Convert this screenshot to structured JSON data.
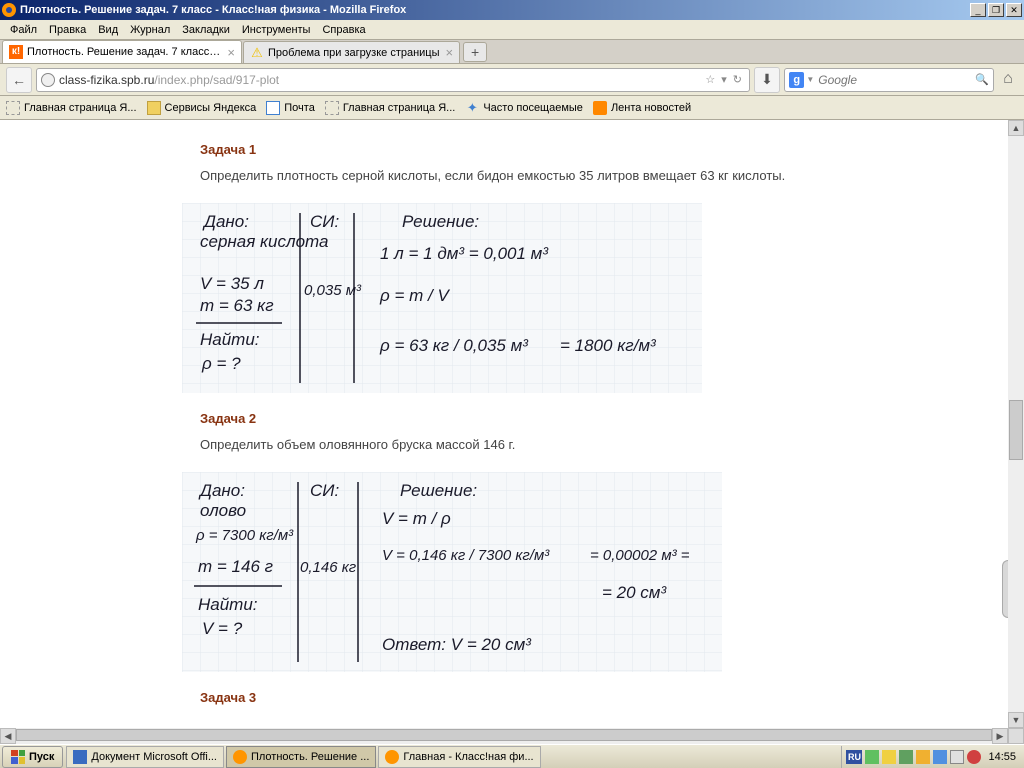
{
  "window": {
    "title": "Плотность. Решение задач. 7 класс - Класс!ная физика - Mozilla Firefox"
  },
  "menu": {
    "file": "Файл",
    "edit": "Правка",
    "view": "Вид",
    "journal": "Журнал",
    "bookmarks": "Закладки",
    "tools": "Инструменты",
    "help": "Справка"
  },
  "tabs": {
    "t1": "Плотность. Решение задач. 7 класс - ...",
    "t2": "Проблема при загрузке страницы"
  },
  "url": {
    "prefix": "class-fizika.spb.ru",
    "path": "/index.php/sad/917-plot"
  },
  "search": {
    "placeholder": "Google"
  },
  "bookmarks": {
    "b1": "Главная страница Я...",
    "b2": "Сервисы Яндекса",
    "b3": "Почта",
    "b4": "Главная страница Я...",
    "b5": "Часто посещаемые",
    "b6": "Лента новостей"
  },
  "content": {
    "task1_title": "Задача 1",
    "task1_text": "Определить плотность серной кислоты, если бидон емкостью 35 литров вмещает 63 кг кислоты.",
    "task2_title": "Задача 2",
    "task2_text": "Определить объем оловянного бруска массой 146 г.",
    "task3_title": "Задача 3",
    "sol1": {
      "given_label": "Дано:",
      "substance": "серная кислота",
      "v": "V = 35 л",
      "m": "m = 63 кг",
      "find_label": "Найти:",
      "find": "ρ = ?",
      "si_label": "СИ:",
      "si_v": "0,035 м³",
      "solve_label": "Решение:",
      "line1": "1 л = 1 дм³ = 0,001 м³",
      "line2": "ρ = m / V",
      "line3a": "ρ = 63 кг / 0,035 м³",
      "line3b": "= 1800 кг/м³"
    },
    "sol2": {
      "given_label": "Дано:",
      "substance": "олово",
      "rho": "ρ = 7300 кг/м³",
      "m": "m = 146 г",
      "find_label": "Найти:",
      "find": "V = ?",
      "si_label": "СИ:",
      "si_m": "0,146 кг",
      "solve_label": "Решение:",
      "line1": "V = m / ρ",
      "line2a": "V = 0,146 кг / 7300 кг/м³",
      "line2b": "= 0,00002 м³ =",
      "line3": "= 20 см³",
      "answer": "Ответ: V = 20 см³"
    }
  },
  "taskbar": {
    "start": "Пуск",
    "t1": "Документ Microsoft Offi...",
    "t2": "Плотность. Решение ...",
    "t3": "Главная - Класс!ная фи...",
    "lang": "RU",
    "clock": "14:55"
  }
}
